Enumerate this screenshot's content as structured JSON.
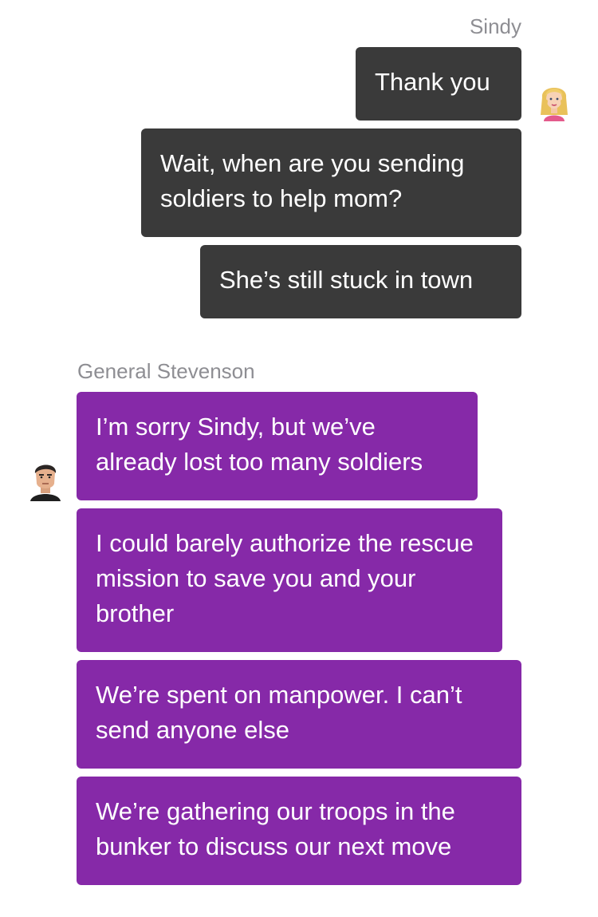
{
  "chat": {
    "outgoing": {
      "sender": "Sindy",
      "messages": [
        "Thank you",
        "Wait, when are you sending soldiers to help mom?",
        "She’s still stuck in town"
      ]
    },
    "incoming": {
      "sender": "General Stevenson",
      "messages": [
        "I’m sorry Sindy, but we’ve already lost too many soldiers",
        "I could barely authorize the rescue mission to save you and your brother",
        "We’re spent on manpower. I can’t send anyone else",
        "We’re gathering our troops in the bunker to discuss our next move"
      ]
    }
  },
  "colors": {
    "outgoing_bubble": "#3a3a3a",
    "incoming_bubble": "#8629a8",
    "sender_name": "#8e8e93"
  },
  "icons": {
    "outgoing_avatar": "sindy-avatar-icon",
    "incoming_avatar": "general-stevenson-avatar-icon"
  }
}
